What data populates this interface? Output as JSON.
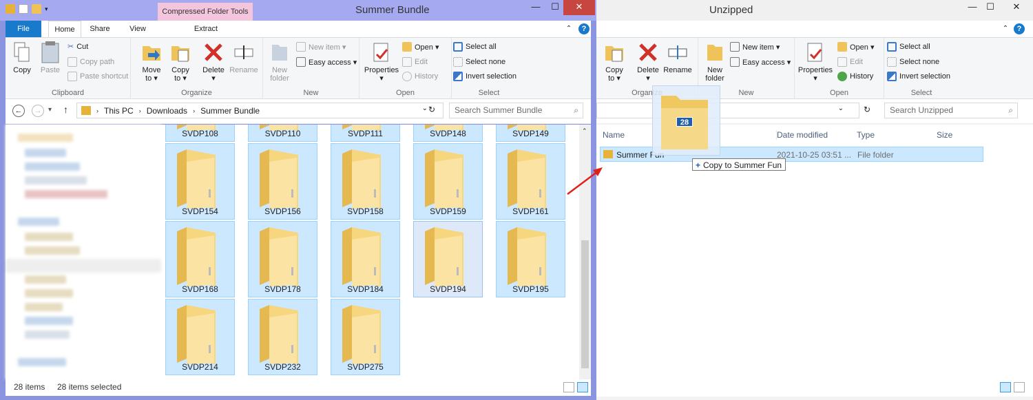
{
  "left_window": {
    "title": "Summer Bundle",
    "context_tab": "Compressed Folder Tools",
    "tabs": [
      "File",
      "Home",
      "Share",
      "View",
      "Extract"
    ],
    "ribbon": {
      "clipboard": {
        "label": "Clipboard",
        "copy": "Copy",
        "paste": "Paste",
        "cut": "Cut",
        "copy_path": "Copy path",
        "paste_shortcut": "Paste shortcut"
      },
      "organize": {
        "label": "Organize",
        "move_to": "Move\nto ▾",
        "copy_to": "Copy\nto ▾",
        "delete": "Delete\n▾",
        "rename": "Rename"
      },
      "new": {
        "label": "New",
        "new_folder": "New\nfolder",
        "new_item": "New item ▾",
        "easy_access": "Easy access ▾"
      },
      "open": {
        "label": "Open",
        "properties": "Properties\n▾",
        "open": "Open ▾",
        "edit": "Edit",
        "history": "History"
      },
      "select": {
        "label": "Select",
        "select_all": "Select all",
        "select_none": "Select none",
        "invert": "Invert selection"
      }
    },
    "breadcrumb": [
      "This PC",
      "Downloads",
      "Summer Bundle"
    ],
    "search_placeholder": "Search Summer Bundle",
    "folders": [
      "SVDP108",
      "SVDP110",
      "SVDP111",
      "SVDP148",
      "SVDP149",
      "SVDP154",
      "SVDP156",
      "SVDP158",
      "SVDP159",
      "SVDP161",
      "SVDP168",
      "SVDP178",
      "SVDP184",
      "SVDP194",
      "SVDP195",
      "SVDP214",
      "SVDP232",
      "SVDP275"
    ],
    "status": {
      "items": "28 items",
      "selected": "28 items selected"
    }
  },
  "right_window": {
    "title": "Unzipped",
    "ribbon": {
      "organize": {
        "label": "Organize",
        "copy_to": "Copy\nto ▾",
        "delete": "Delete\n▾",
        "rename": "Rename"
      },
      "new": {
        "label": "New",
        "new_folder": "New\nfolder",
        "new_item": "New item ▾",
        "easy_access": "Easy access ▾"
      },
      "open": {
        "label": "Open",
        "properties": "Properties\n▾",
        "open": "Open ▾",
        "edit": "Edit",
        "history": "History"
      },
      "select": {
        "label": "Select",
        "select_all": "Select all",
        "select_none": "Select none",
        "invert": "Invert selection"
      }
    },
    "search_placeholder": "Search Unzipped",
    "columns": [
      "Name",
      "Date modified",
      "Type",
      "Size"
    ],
    "row": {
      "name": "Summer Fun",
      "date": "2021-10-25 03:51 ...",
      "type": "File folder"
    }
  },
  "drag": {
    "count": "28",
    "tooltip": "Copy to Summer Fun"
  },
  "colors": {
    "accent": "#1979ca",
    "selection": "#cce8ff",
    "arrow": "#e0201b"
  }
}
